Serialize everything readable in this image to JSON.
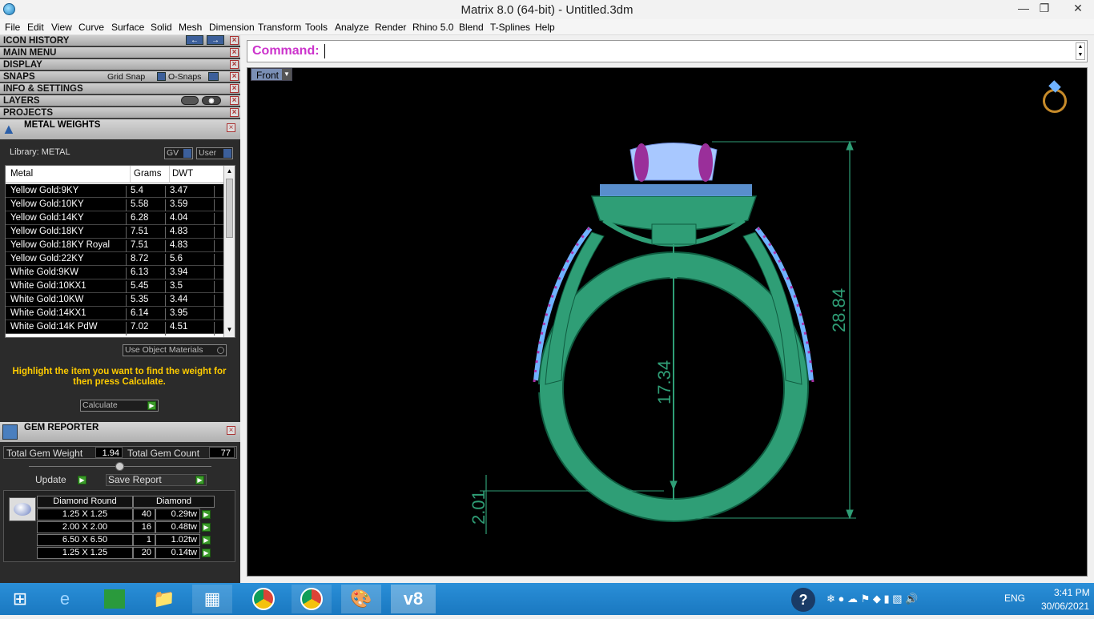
{
  "window": {
    "title": "Matrix 8.0 (64-bit) - Untitled.3dm"
  },
  "menu": [
    "File",
    "Edit",
    "View",
    "Curve",
    "Surface",
    "Solid",
    "Mesh",
    "Dimension",
    "Transform",
    "Tools",
    "Analyze",
    "Render",
    "Rhino 5.0",
    "Blend",
    "T-Splines",
    "Help"
  ],
  "panels": {
    "icon_history": "ICON HISTORY",
    "main_menu": "MAIN MENU",
    "display": "DISPLAY",
    "snaps": "SNAPS",
    "grid_snap": "Grid Snap",
    "o_snaps": "O-Snaps",
    "info_settings": "INFO & SETTINGS",
    "layers": "LAYERS",
    "projects": "PROJECTS"
  },
  "metal_weights": {
    "title": "METAL WEIGHTS",
    "library": "Library: METAL",
    "gv": "GV",
    "user": "User",
    "columns": [
      "Metal",
      "Grams",
      "DWT"
    ],
    "rows": [
      {
        "metal": "Yellow Gold:9KY",
        "grams": "5.4",
        "dwt": "3.47"
      },
      {
        "metal": "Yellow Gold:10KY",
        "grams": "5.58",
        "dwt": "3.59"
      },
      {
        "metal": "Yellow Gold:14KY",
        "grams": "6.28",
        "dwt": "4.04"
      },
      {
        "metal": "Yellow Gold:18KY",
        "grams": "7.51",
        "dwt": "4.83"
      },
      {
        "metal": "Yellow Gold:18KY Royal",
        "grams": "7.51",
        "dwt": "4.83"
      },
      {
        "metal": "Yellow Gold:22KY",
        "grams": "8.72",
        "dwt": "5.6"
      },
      {
        "metal": "White Gold:9KW",
        "grams": "6.13",
        "dwt": "3.94"
      },
      {
        "metal": "White Gold:10KX1",
        "grams": "5.45",
        "dwt": "3.5"
      },
      {
        "metal": "White Gold:10KW",
        "grams": "5.35",
        "dwt": "3.44"
      },
      {
        "metal": "White Gold:14KX1",
        "grams": "6.14",
        "dwt": "3.95"
      },
      {
        "metal": "White Gold:14K PdW",
        "grams": "7.02",
        "dwt": "4.51"
      }
    ],
    "use_object_materials": "Use Object Materials",
    "hint": "Highlight the item you want to find the weight for then press Calculate.",
    "calculate": "Calculate"
  },
  "gem_reporter": {
    "title": "GEM REPORTER",
    "total_weight_label": "Total Gem Weight",
    "total_weight": "1.94",
    "total_count_label": "Total Gem Count",
    "total_count": "77",
    "update": "Update",
    "save_report": "Save Report",
    "shape_header": "Diamond Round",
    "type_header": "Diamond",
    "rows": [
      {
        "size": "1.25 X 1.25",
        "count": "40",
        "weight": "0.29tw"
      },
      {
        "size": "2.00 X 2.00",
        "count": "16",
        "weight": "0.48tw"
      },
      {
        "size": "6.50 X 6.50",
        "count": "1",
        "weight": "1.02tw"
      },
      {
        "size": "1.25 X 1.25",
        "count": "20",
        "weight": "0.14tw"
      }
    ]
  },
  "command": {
    "label": "Command:"
  },
  "viewport": {
    "name": "Front",
    "dimensions": {
      "height_total": "28.84",
      "inner": "17.34",
      "shank": "2.01"
    }
  },
  "taskbar": {
    "lang": "ENG",
    "time": "3:41 PM",
    "date": "30/06/2021"
  }
}
